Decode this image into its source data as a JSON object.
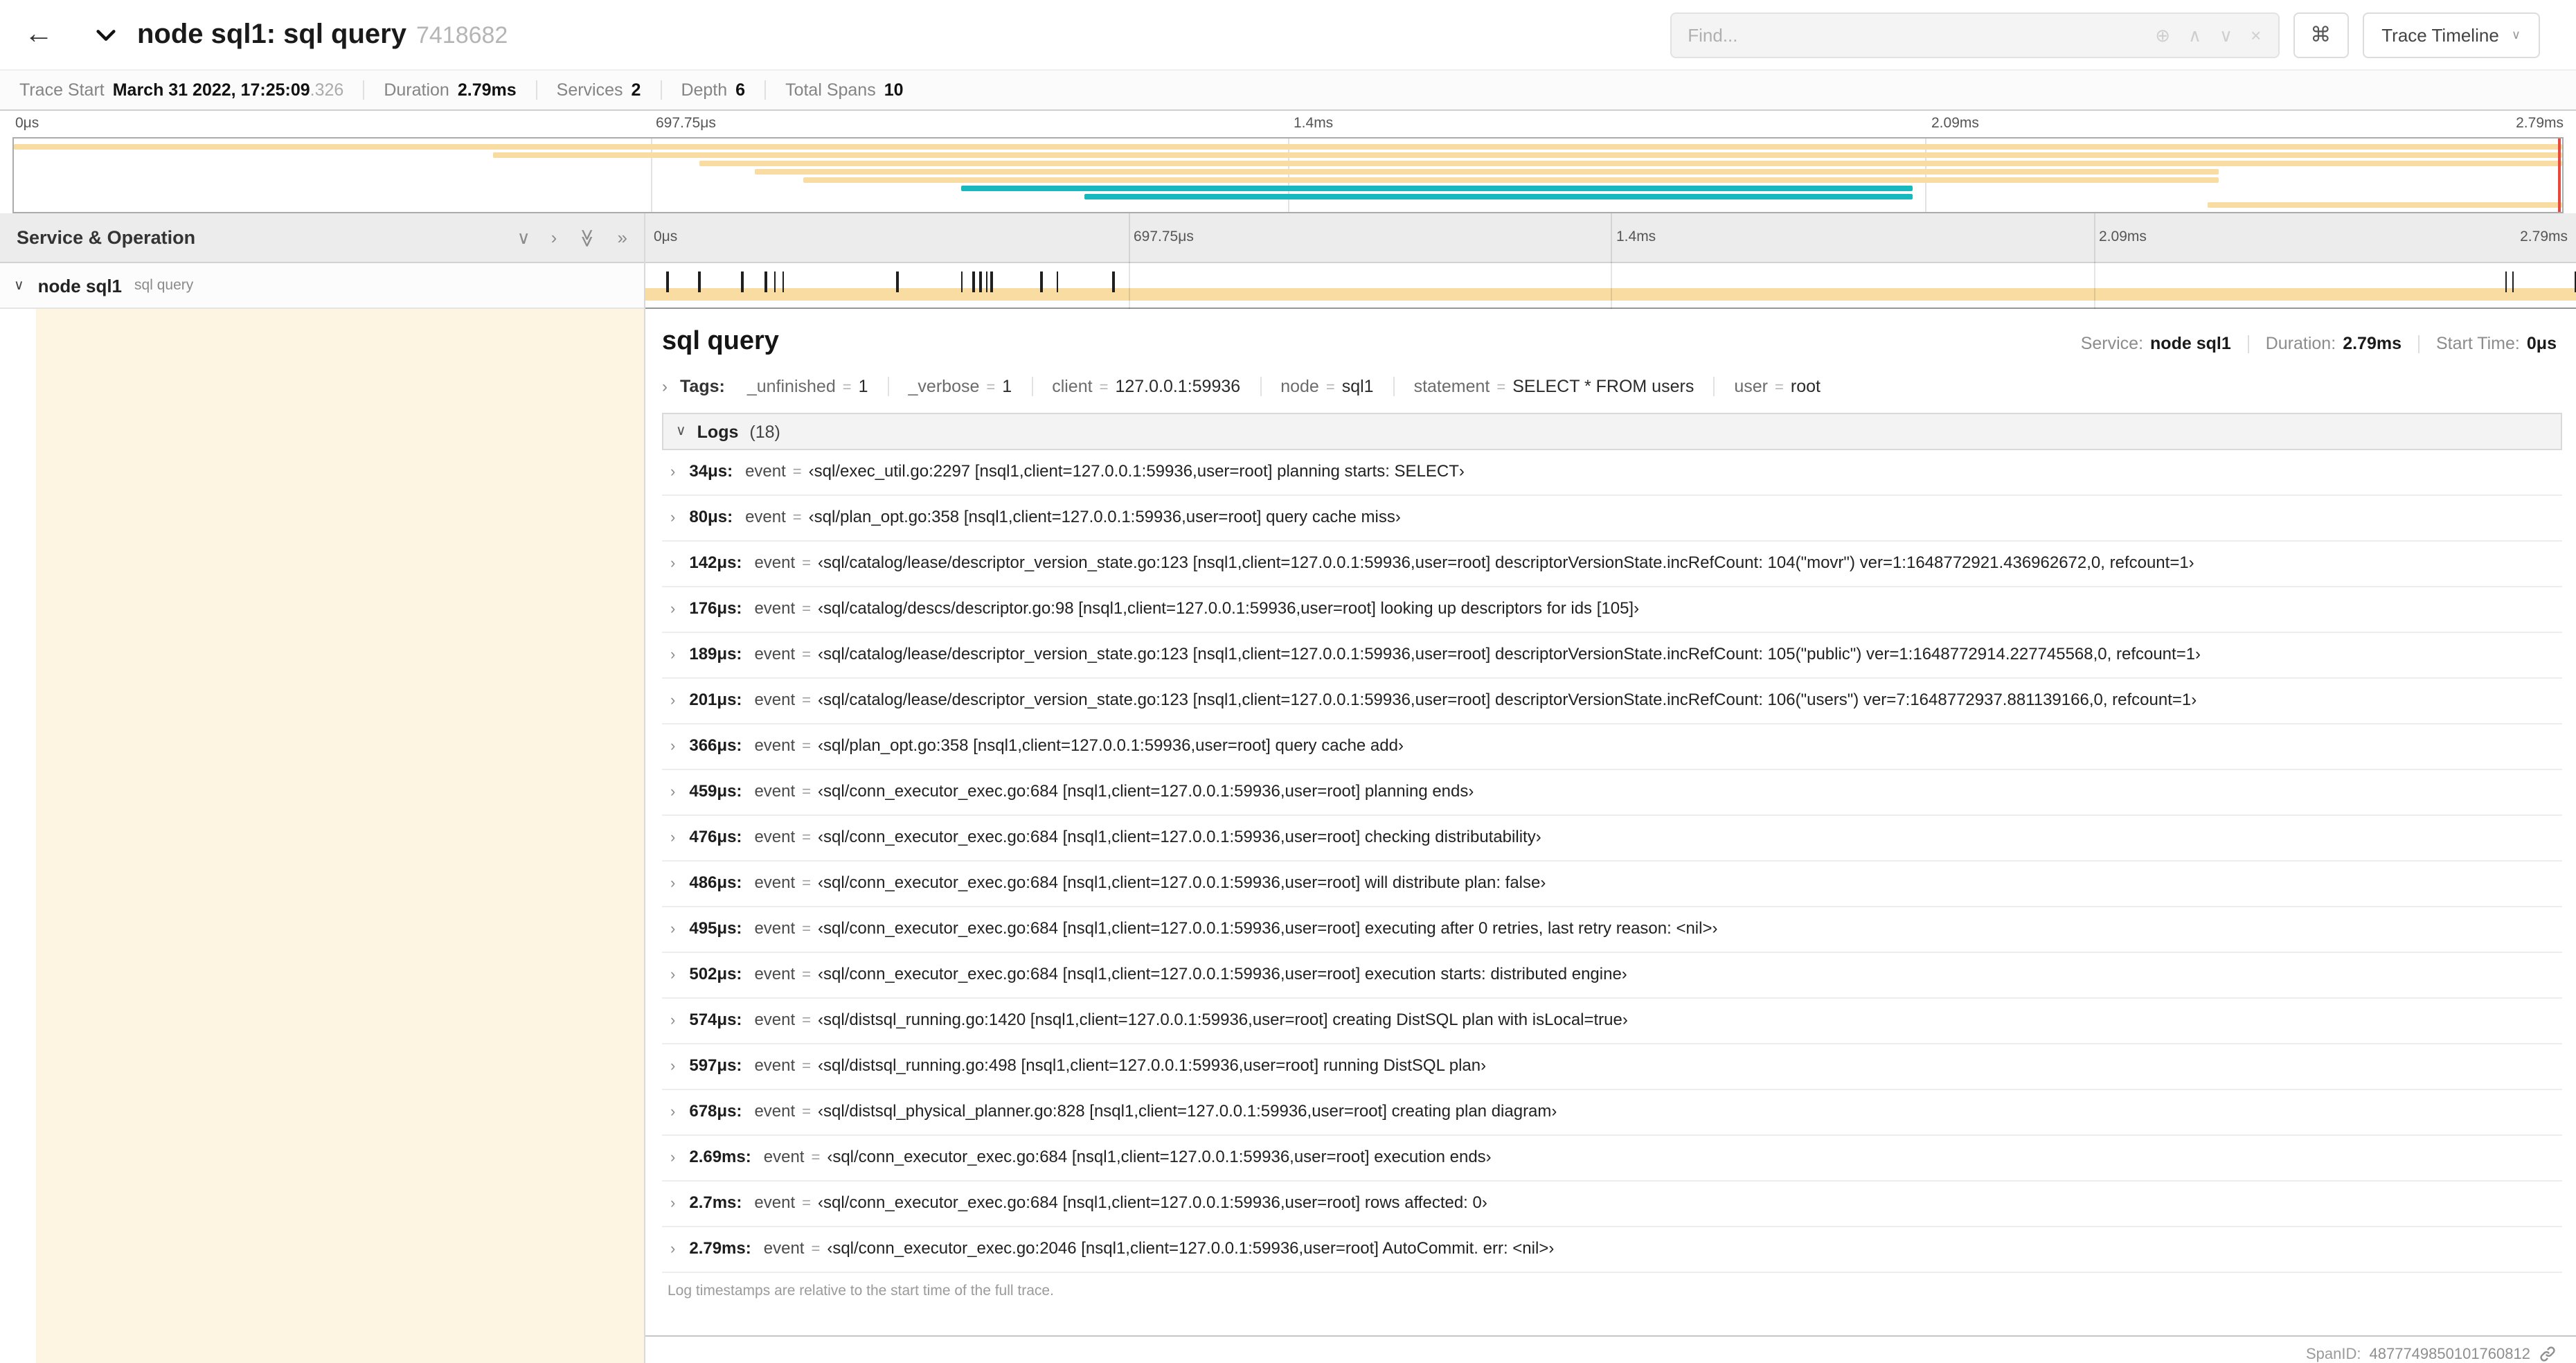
{
  "header": {
    "back_icon": "←",
    "title": "node sql1: sql query",
    "trace_id": "7418682",
    "find": {
      "placeholder": "Find..."
    },
    "find_icons": {
      "zoom": "⊕",
      "prev": "∧",
      "next": "∨",
      "clear": "×"
    },
    "shortcuts_label": "⌘",
    "view_dropdown": {
      "label": "Trace Timeline",
      "chevron": "∨"
    }
  },
  "summary": {
    "items": [
      {
        "label": "Trace Start",
        "value": "March 31 2022, 17:25:09",
        "suffix": ".326"
      },
      {
        "label": "Duration",
        "value": "2.79ms",
        "suffix": ""
      },
      {
        "label": "Services",
        "value": "2",
        "suffix": ""
      },
      {
        "label": "Depth",
        "value": "6",
        "suffix": ""
      },
      {
        "label": "Total Spans",
        "value": "10",
        "suffix": ""
      }
    ]
  },
  "timeline": {
    "duration_us": 2790,
    "ticks": [
      "0μs",
      "697.75μs",
      "1.4ms",
      "2.09ms",
      "2.79ms"
    ]
  },
  "minimap": {
    "colors": {
      "tan": "#F8DCA1",
      "teal": "#17B8BE"
    },
    "cursor_color": "#e64a3c",
    "spans": [
      {
        "start": 0,
        "end": 100,
        "color": "tan"
      },
      {
        "start": 18.8,
        "end": 100,
        "color": "tan"
      },
      {
        "start": 26.9,
        "end": 100,
        "color": "tan"
      },
      {
        "start": 29.1,
        "end": 86.5,
        "color": "tan"
      },
      {
        "start": 31.0,
        "end": 86.5,
        "color": "tan"
      },
      {
        "start": 37.2,
        "end": 74.5,
        "color": "teal"
      },
      {
        "start": 42.0,
        "end": 74.5,
        "color": "teal"
      },
      {
        "start": 86.1,
        "end": 100,
        "color": "tan"
      }
    ]
  },
  "left_panel": {
    "title": "Service & Operation",
    "row": {
      "chevron": "∨",
      "service": "node sql1",
      "operation": "sql query"
    }
  },
  "detail": {
    "title": "sql query",
    "meta": [
      {
        "label": "Service:",
        "value": "node sql1"
      },
      {
        "label": "Duration:",
        "value": "2.79ms"
      },
      {
        "label": "Start Time:",
        "value": "0μs"
      }
    ],
    "tags_label": "Tags:",
    "tags": [
      {
        "key": "_unfinished",
        "value": "1"
      },
      {
        "key": "_verbose",
        "value": "1"
      },
      {
        "key": "client",
        "value": "127.0.0.1:59936"
      },
      {
        "key": "node",
        "value": "sql1"
      },
      {
        "key": "statement",
        "value": "SELECT * FROM users"
      },
      {
        "key": "user",
        "value": "root"
      }
    ],
    "logs_title": "Logs",
    "logs_count": "(18)",
    "logs": [
      {
        "time": "34μs:",
        "us": 34,
        "key": "event",
        "value": "‹sql/exec_util.go:2297 [nsql1,client=127.0.0.1:59936,user=root] planning starts: SELECT›"
      },
      {
        "time": "80μs:",
        "us": 80,
        "key": "event",
        "value": "‹sql/plan_opt.go:358 [nsql1,client=127.0.0.1:59936,user=root] query cache miss›"
      },
      {
        "time": "142μs:",
        "us": 142,
        "key": "event",
        "value": "‹sql/catalog/lease/descriptor_version_state.go:123 [nsql1,client=127.0.0.1:59936,user=root] descriptorVersionState.incRefCount: 104(\"movr\") ver=1:1648772921.436962672,0, refcount=1›"
      },
      {
        "time": "176μs:",
        "us": 176,
        "key": "event",
        "value": "‹sql/catalog/descs/descriptor.go:98 [nsql1,client=127.0.0.1:59936,user=root] looking up descriptors for ids [105]›"
      },
      {
        "time": "189μs:",
        "us": 189,
        "key": "event",
        "value": "‹sql/catalog/lease/descriptor_version_state.go:123 [nsql1,client=127.0.0.1:59936,user=root] descriptorVersionState.incRefCount: 105(\"public\") ver=1:1648772914.227745568,0, refcount=1›"
      },
      {
        "time": "201μs:",
        "us": 201,
        "key": "event",
        "value": "‹sql/catalog/lease/descriptor_version_state.go:123 [nsql1,client=127.0.0.1:59936,user=root] descriptorVersionState.incRefCount: 106(\"users\") ver=7:1648772937.881139166,0, refcount=1›"
      },
      {
        "time": "366μs:",
        "us": 366,
        "key": "event",
        "value": "‹sql/plan_opt.go:358 [nsql1,client=127.0.0.1:59936,user=root] query cache add›"
      },
      {
        "time": "459μs:",
        "us": 459,
        "key": "event",
        "value": "‹sql/conn_executor_exec.go:684 [nsql1,client=127.0.0.1:59936,user=root] planning ends›"
      },
      {
        "time": "476μs:",
        "us": 476,
        "key": "event",
        "value": "‹sql/conn_executor_exec.go:684 [nsql1,client=127.0.0.1:59936,user=root] checking distributability›"
      },
      {
        "time": "486μs:",
        "us": 486,
        "key": "event",
        "value": "‹sql/conn_executor_exec.go:684 [nsql1,client=127.0.0.1:59936,user=root] will distribute plan: false›"
      },
      {
        "time": "495μs:",
        "us": 495,
        "key": "event",
        "value": "‹sql/conn_executor_exec.go:684 [nsql1,client=127.0.0.1:59936,user=root] executing after 0 retries, last retry reason: <nil>›"
      },
      {
        "time": "502μs:",
        "us": 502,
        "key": "event",
        "value": "‹sql/conn_executor_exec.go:684 [nsql1,client=127.0.0.1:59936,user=root] execution starts: distributed engine›"
      },
      {
        "time": "574μs:",
        "us": 574,
        "key": "event",
        "value": "‹sql/distsql_running.go:1420 [nsql1,client=127.0.0.1:59936,user=root] creating DistSQL plan with isLocal=true›"
      },
      {
        "time": "597μs:",
        "us": 597,
        "key": "event",
        "value": "‹sql/distsql_running.go:498 [nsql1,client=127.0.0.1:59936,user=root] running DistSQL plan›"
      },
      {
        "time": "678μs:",
        "us": 678,
        "key": "event",
        "value": "‹sql/distsql_physical_planner.go:828 [nsql1,client=127.0.0.1:59936,user=root] creating plan diagram›"
      },
      {
        "time": "2.69ms:",
        "us": 2690,
        "key": "event",
        "value": "‹sql/conn_executor_exec.go:684 [nsql1,client=127.0.0.1:59936,user=root] execution ends›"
      },
      {
        "time": "2.7ms:",
        "us": 2700,
        "key": "event",
        "value": "‹sql/conn_executor_exec.go:684 [nsql1,client=127.0.0.1:59936,user=root] rows affected: 0›"
      },
      {
        "time": "2.79ms:",
        "us": 2790,
        "key": "event",
        "value": "‹sql/conn_executor_exec.go:2046 [nsql1,client=127.0.0.1:59936,user=root] AutoCommit. err: <nil>›"
      }
    ],
    "logs_note": "Log timestamps are relative to the start time of the full trace.",
    "span_id_label": "SpanID:",
    "span_id": "4877749850101760812"
  }
}
